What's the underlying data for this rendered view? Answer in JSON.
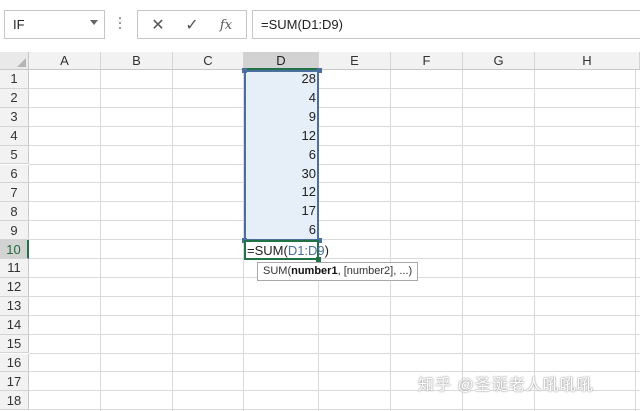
{
  "name_box": {
    "value": "IF"
  },
  "formula_bar": {
    "buttons": {
      "cancel": "✕",
      "enter": "✓",
      "fx": "fx"
    },
    "value": "=SUM(D1:D9)"
  },
  "columns": [
    "A",
    "B",
    "C",
    "D",
    "E",
    "F",
    "G",
    "H"
  ],
  "rows": [
    "1",
    "2",
    "3",
    "4",
    "5",
    "6",
    "7",
    "8",
    "9",
    "10",
    "11",
    "12",
    "13",
    "14",
    "15",
    "16",
    "17",
    "18"
  ],
  "selected_column": "D",
  "selected_row": "10",
  "column_d_values": [
    "28",
    "4",
    "9",
    "12",
    "6",
    "30",
    "12",
    "17",
    "6"
  ],
  "editing_cell": {
    "prefix": "=SUM(",
    "ref": "D1:D9",
    "suffix": ")"
  },
  "tooltip": {
    "func": "SUM(",
    "arg1": "number1",
    "rest": ", [number2], ...)"
  },
  "watermark": "知乎 @圣诞老人吼吼吼",
  "colors": {
    "selection_border": "#4b6f9e",
    "selection_fill": "#e6eef8",
    "active_border": "#217346"
  }
}
